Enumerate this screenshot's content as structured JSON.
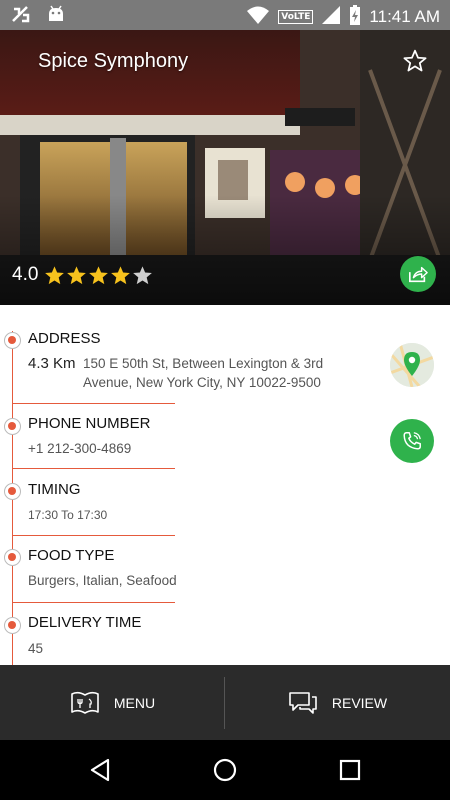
{
  "status_bar": {
    "time": "11:41 AM",
    "network": "VoLTE",
    "icons": [
      "no-sim-icon",
      "android-icon",
      "wifi-icon",
      "signal-icon",
      "battery-charging-icon"
    ]
  },
  "restaurant": {
    "name": "Spice Symphony",
    "rating": "4.0",
    "rating_value": 4.0,
    "rating_max": 5
  },
  "details": {
    "address": {
      "label": "ADDRESS",
      "distance": "4.3 Km",
      "line1": "150 E 50th St, Between Lexington & 3rd",
      "line2": "Avenue, New York City, NY 10022-9500"
    },
    "phone": {
      "label": "PHONE NUMBER",
      "value": "+1 212-300-4869"
    },
    "timing": {
      "label": "TIMING",
      "value": "17:30 To 17:30"
    },
    "food_type": {
      "label": "FOOD TYPE",
      "value": "Burgers, Italian, Seafood"
    },
    "delivery_time": {
      "label": "DELIVERY TIME",
      "value": "45"
    }
  },
  "bottom_bar": {
    "menu_label": "MENU",
    "review_label": "REVIEW"
  },
  "colors": {
    "accent": "#e55a3c",
    "green": "#2fb24c",
    "star": "#f7c21d",
    "bottom_bar": "#2b2b2b"
  }
}
